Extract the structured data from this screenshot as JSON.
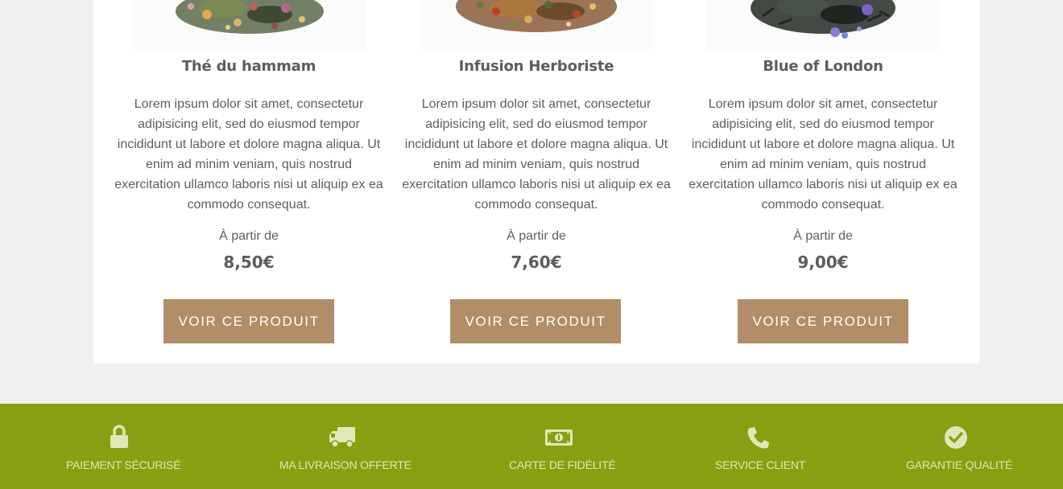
{
  "products": [
    {
      "name": "Thé du hammam",
      "description": "Lorem ipsum dolor sit amet, consectetur adipisicing elit, sed do eiusmod tempor incididunt ut labore et dolore magna aliqua. Ut enim ad minim veniam, quis nostrud exercitation ullamco laboris nisi ut aliquip ex ea commodo consequat.",
      "from_label": "À partir de",
      "price": "8,50€",
      "button_label": "VOIR CE PRODUIT",
      "image_icon": "tea-leaves-image"
    },
    {
      "name": "Infusion Herboriste",
      "description": "Lorem ipsum dolor sit amet, consectetur adipisicing elit, sed do eiusmod tempor incididunt ut labore et dolore magna aliqua. Ut enim ad minim veniam, quis nostrud exercitation ullamco laboris nisi ut aliquip ex ea commodo consequat.",
      "from_label": "À partir de",
      "price": "7,60€",
      "button_label": "VOIR CE PRODUIT",
      "image_icon": "herbal-infusion-image"
    },
    {
      "name": "Blue of London",
      "description": "Lorem ipsum dolor sit amet, consectetur adipisicing elit, sed do eiusmod tempor incididunt ut labore et dolore magna aliqua. Ut enim ad minim veniam, quis nostrud exercitation ullamco laboris nisi ut aliquip ex ea commodo consequat.",
      "from_label": "À partir de",
      "price": "9,00€",
      "button_label": "VOIR CE PRODUIT",
      "image_icon": "black-tea-image"
    }
  ],
  "features": [
    {
      "label": "PAIEMENT SÉCURISÉ",
      "icon": "lock-icon"
    },
    {
      "label": "MA LIVRAISON OFFERTE",
      "icon": "truck-icon"
    },
    {
      "label": "CARTE DE FIDÉLITÉ",
      "icon": "money-icon"
    },
    {
      "label": "SERVICE CLIENT",
      "icon": "phone-icon"
    },
    {
      "label": "GARANTIE QUALITÉ",
      "icon": "check-circle-icon"
    }
  ],
  "colors": {
    "button": "#b18e67",
    "footer": "#86a012",
    "footer_text": "#dfe9b8",
    "page_background": "#f1f1f1"
  }
}
